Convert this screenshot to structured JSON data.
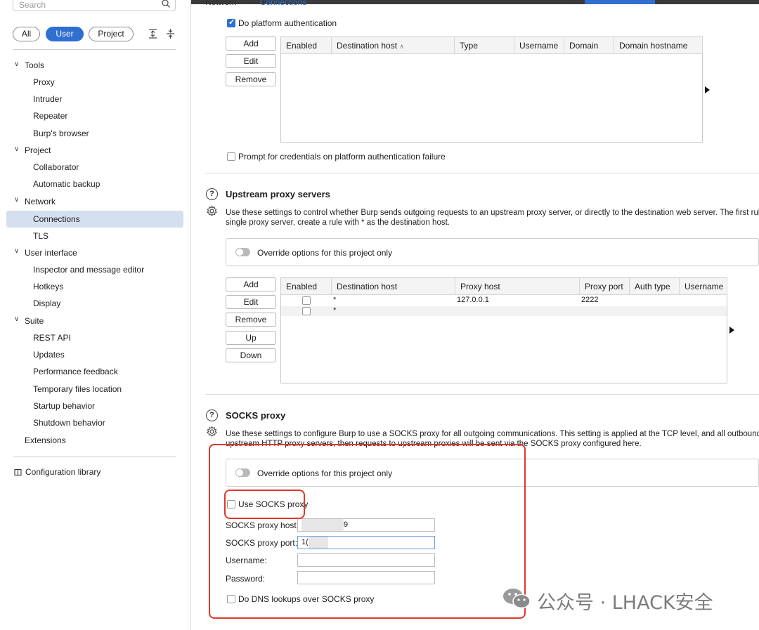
{
  "sidebar": {
    "search_placeholder": "Search",
    "filters": [
      "All",
      "User",
      "Project"
    ],
    "tree": [
      {
        "label": "Tools",
        "level": 0,
        "expanded": true
      },
      {
        "label": "Proxy",
        "level": 1
      },
      {
        "label": "Intruder",
        "level": 1
      },
      {
        "label": "Repeater",
        "level": 1
      },
      {
        "label": "Burp's browser",
        "level": 1
      },
      {
        "label": "Project",
        "level": 0,
        "expanded": true
      },
      {
        "label": "Collaborator",
        "level": 1
      },
      {
        "label": "Automatic backup",
        "level": 1
      },
      {
        "label": "Network",
        "level": 0,
        "expanded": true
      },
      {
        "label": "Connections",
        "level": 1,
        "selected": true
      },
      {
        "label": "TLS",
        "level": 1
      },
      {
        "label": "User interface",
        "level": 0,
        "expanded": true
      },
      {
        "label": "Inspector and message editor",
        "level": 1
      },
      {
        "label": "Hotkeys",
        "level": 1
      },
      {
        "label": "Display",
        "level": 1
      },
      {
        "label": "Suite",
        "level": 0,
        "expanded": true
      },
      {
        "label": "REST API",
        "level": 1
      },
      {
        "label": "Updates",
        "level": 1
      },
      {
        "label": "Performance feedback",
        "level": 1
      },
      {
        "label": "Temporary files location",
        "level": 1
      },
      {
        "label": "Startup behavior",
        "level": 1
      },
      {
        "label": "Shutdown behavior",
        "level": 1
      },
      {
        "label": "Extensions",
        "level": 0
      }
    ],
    "config_library": "Configuration library"
  },
  "breadcrumb": {
    "parent": "Network",
    "sep": ">",
    "current": "Connections"
  },
  "platform_auth": {
    "do_platform_auth": "Do platform authentication",
    "buttons": [
      "Add",
      "Edit",
      "Remove"
    ],
    "columns": [
      "Enabled",
      "Destination host",
      "Type",
      "Username",
      "Domain",
      "Domain hostname"
    ],
    "prompt_label": "Prompt for credentials on platform authentication failure"
  },
  "upstream": {
    "title": "Upstream proxy servers",
    "desc_line1": "Use these settings to control whether Burp sends outgoing requests to an upstream proxy server, or directly to the destination web server. The first rule t",
    "desc_line2": "single proxy server, create a rule with * as the destination host.",
    "override_label": "Override options for this project only",
    "buttons": [
      "Add",
      "Edit",
      "Remove",
      "Up",
      "Down"
    ],
    "columns": [
      "Enabled",
      "Destination host",
      "Proxy host",
      "Proxy port",
      "Auth type",
      "Username"
    ],
    "rows": [
      {
        "host": "*",
        "proxy_host": "127.0.0.1",
        "proxy_port": "2222"
      },
      {
        "host": "*",
        "proxy_host": "",
        "proxy_port": ""
      }
    ]
  },
  "socks": {
    "title": "SOCKS proxy",
    "desc_line1": "Use these settings to configure Burp to use a SOCKS proxy for all outgoing communications. This setting is applied at the TCP level, and all outbound req",
    "desc_line2": "upstream HTTP proxy servers, then requests to upstream proxies will be sent via the SOCKS proxy configured here.",
    "override_label": "Override options for this project only",
    "use_socks": "Use SOCKS proxy",
    "host_label": "SOCKS proxy host:",
    "host_value_visible": "9",
    "port_label": "SOCKS proxy port:",
    "port_value_visible": "1(",
    "username_label": "Username:",
    "password_label": "Password:",
    "dns_label": "Do DNS lookups over SOCKS proxy"
  },
  "watermark": "公众号 · LHACK安全",
  "colors": {
    "accent": "#2f6fd0",
    "highlight": "#e0372c",
    "selection": "#d4dff0"
  }
}
